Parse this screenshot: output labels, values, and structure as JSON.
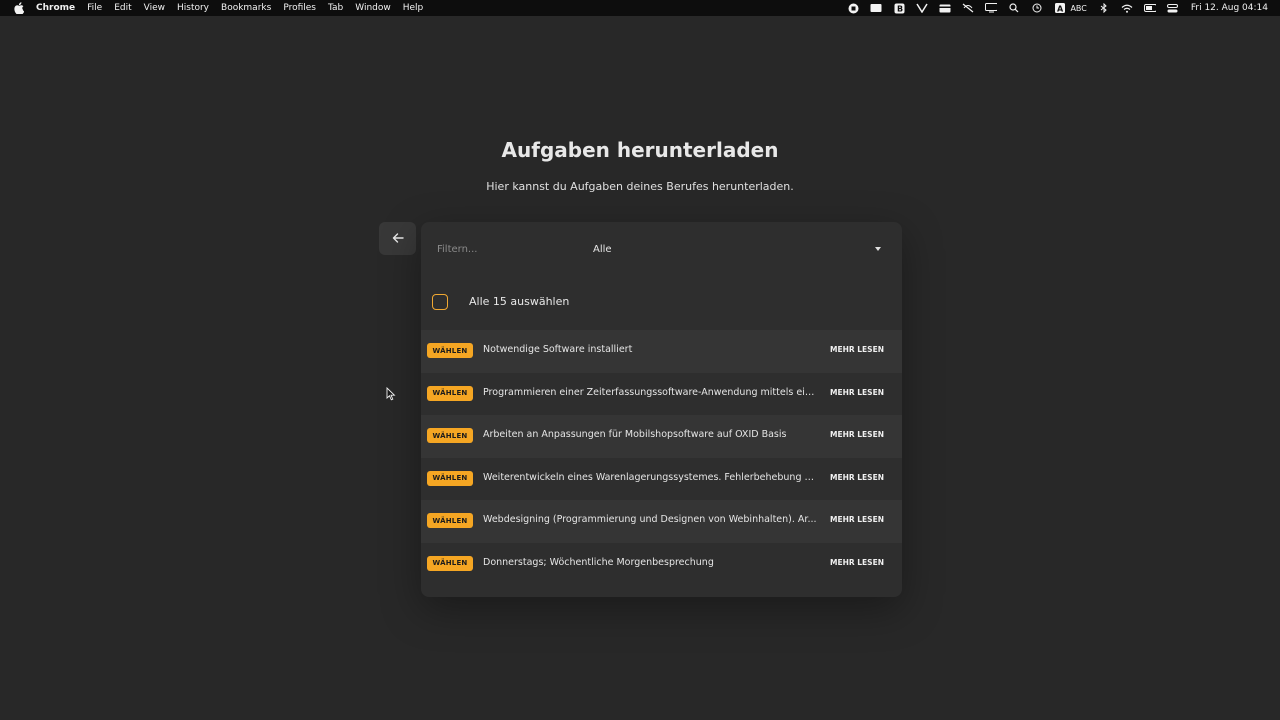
{
  "menubar": {
    "app": "Chrome",
    "items": [
      "File",
      "Edit",
      "View",
      "History",
      "Bookmarks",
      "Profiles",
      "Tab",
      "Window",
      "Help"
    ],
    "input_source": "ABC",
    "clock": "Fri 12. Aug  04:14"
  },
  "page": {
    "title": "Aufgaben herunterladen",
    "subtitle": "Hier kannst du Aufgaben deines Berufes herunterladen."
  },
  "filter": {
    "placeholder": "Filtern...",
    "value": "",
    "select_value": "Alle"
  },
  "select_all": {
    "label": "Alle 15 auswählen",
    "checked": false
  },
  "tasks": [
    {
      "button": "WÄHLEN",
      "title": "Notwendige Software installiert",
      "link": "MEHR LESEN"
    },
    {
      "button": "WÄHLEN",
      "title": "Programmieren einer Zeiterfassungssoftware-Anwendung mittels ein...",
      "link": "MEHR LESEN"
    },
    {
      "button": "WÄHLEN",
      "title": "Arbeiten an Anpassungen für Mobilshopsoftware auf OXID Basis",
      "link": "MEHR LESEN"
    },
    {
      "button": "WÄHLEN",
      "title": "Weiterentwickeln eines Warenlagerungssystemes. Fehlerbehebung al...",
      "link": "MEHR LESEN"
    },
    {
      "button": "WÄHLEN",
      "title": "Webdesigning (Programmierung und Designen von Webinhalten). Ar...",
      "link": "MEHR LESEN"
    },
    {
      "button": "WÄHLEN",
      "title": "Donnerstags; Wöchentliche Morgenbesprechung",
      "link": "MEHR LESEN"
    }
  ],
  "colors": {
    "background": "#282828",
    "panel": "#2e2e2e",
    "accent": "#f5a623"
  }
}
